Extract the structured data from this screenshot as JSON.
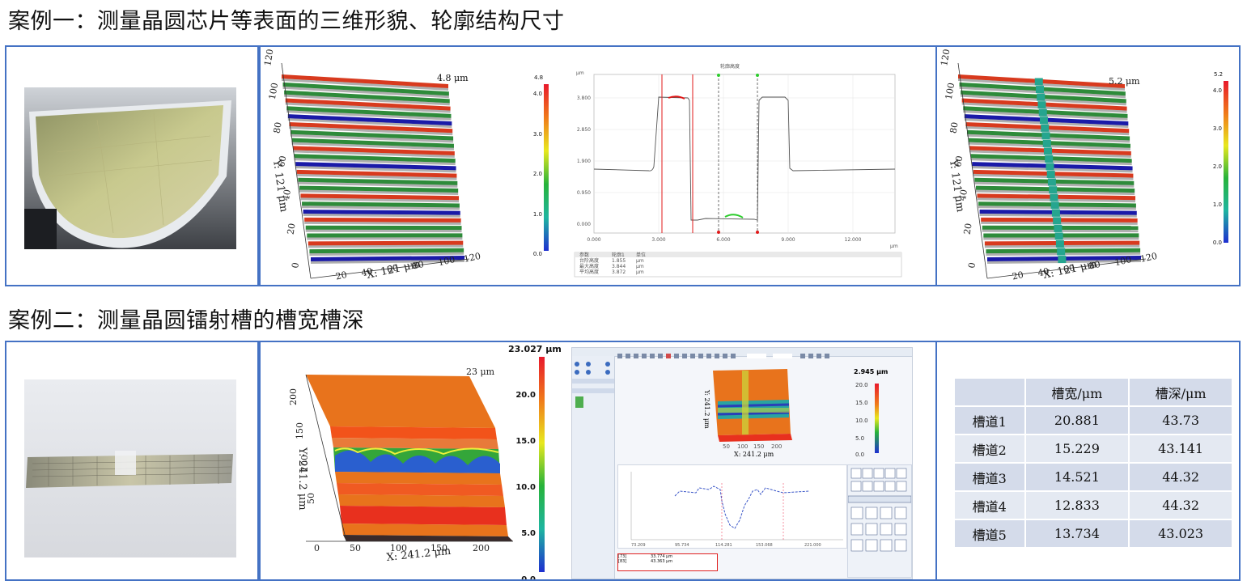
{
  "case1": {
    "title": "案例一：测量晶圆芯片等表面的三维形貌、轮廓结构尺寸",
    "model_left": {
      "peak_label": "4.8 μm",
      "y_axis_label": "Y: 121 μm",
      "x_axis_label": "X: 121 μm",
      "y_ticks": [
        "120",
        "100",
        "80",
        "60",
        "40",
        "20",
        "0"
      ],
      "x_ticks": [
        "20",
        "40",
        "60",
        "80",
        "100",
        "120"
      ],
      "colorbar_top": "4.8",
      "colorbar_ticks": [
        "4.0",
        "3.0",
        "2.0",
        "1.0",
        "0.0"
      ]
    },
    "profile": {
      "title": "轮廓高度",
      "y_unit": "μm",
      "x_unit": "μm",
      "y_ticks": [
        "3.800",
        "2.850",
        "1.900",
        "0.950",
        "0.000"
      ],
      "x_ticks": [
        "0.000",
        "3.000",
        "6.000",
        "9.000",
        "12.000"
      ],
      "table_headers": [
        "参数",
        "轮廓1",
        "单位"
      ],
      "table_rows": [
        [
          "台阶高度",
          "1.855",
          "μm"
        ],
        [
          "最大高度",
          "3.844",
          "μm"
        ],
        [
          "平均高度",
          "3.872",
          "μm"
        ]
      ]
    },
    "model_right": {
      "peak_label": "5.2 μm",
      "y_axis_label": "Y: 121 μm",
      "x_axis_label": "X: 121 μm",
      "y_ticks": [
        "120",
        "100",
        "80",
        "60",
        "40",
        "20",
        "0"
      ],
      "x_ticks": [
        "20",
        "40",
        "60",
        "80",
        "100",
        "120"
      ],
      "colorbar_top": "5.2",
      "colorbar_ticks": [
        "4.0",
        "3.0",
        "2.0",
        "1.0",
        "0.0"
      ]
    }
  },
  "case2": {
    "title": "案例二：测量晶圆镭射槽的槽宽槽深",
    "model": {
      "peak_label": "23 μm",
      "y_axis_label": "Y: 241.2 μm",
      "x_axis_label": "X: 241.2 μm",
      "y_ticks": [
        "200",
        "150",
        "100",
        "50",
        "0"
      ],
      "x_ticks": [
        "50",
        "100",
        "150",
        "200"
      ],
      "colorbar_top": "23.027 μm",
      "colorbar_ticks": [
        "20.0",
        "15.0",
        "10.0",
        "5.0",
        "0.0"
      ]
    },
    "software": {
      "colorbar_top": "2.945 μm",
      "colorbar_ticks": [
        "20.0",
        "15.0",
        "10.0",
        "5.0",
        "0.0"
      ],
      "mini_x_label": "X: 241.2 μm",
      "mini_y_label": "Y: 241.2 μm",
      "mini_x_ticks": [
        "50",
        "100",
        "150",
        "200"
      ],
      "profile_x_ticks": [
        "73.209",
        "95.734",
        "114.281",
        "153.068",
        "221.000"
      ],
      "result_rows": [
        [
          "[73]",
          "33.774 μm"
        ],
        [
          "[83]",
          "43.363 μm"
        ]
      ]
    },
    "table": {
      "headers": [
        "",
        "槽宽/μm",
        "槽深/μm"
      ],
      "rows": [
        {
          "name": "槽道1",
          "width": "20.881",
          "depth": "43.73"
        },
        {
          "name": "槽道2",
          "width": "15.229",
          "depth": "43.141"
        },
        {
          "name": "槽道3",
          "width": "14.521",
          "depth": "44.32"
        },
        {
          "name": "槽道4",
          "width": "12.833",
          "depth": "44.32"
        },
        {
          "name": "槽道5",
          "width": "13.734",
          "depth": "43.023"
        }
      ]
    }
  },
  "colors": {
    "frame": "#4472c4",
    "stripe_red": "#d83a1e",
    "stripe_green": "#2e8b3a",
    "stripe_blue": "#1a1aa8",
    "orange_surface": "#e8731c"
  }
}
